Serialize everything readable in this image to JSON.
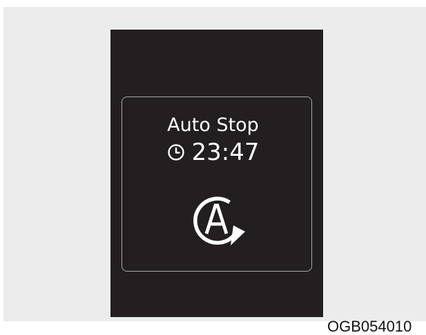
{
  "popup": {
    "title": "Auto Stop",
    "timer": "23:47",
    "icons": {
      "timer": "clock-icon",
      "status": "auto-stop-a-icon"
    }
  },
  "caption": "OGB054010",
  "colors": {
    "page_background": "#ececec",
    "display_background": "#231f20",
    "popup_border": "#a8a8a8",
    "text": "#ffffff"
  }
}
